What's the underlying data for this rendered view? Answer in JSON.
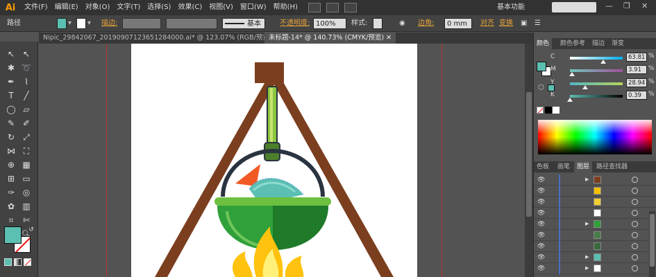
{
  "app": {
    "logo": "Ai"
  },
  "menu": [
    "文件(F)",
    "编辑(E)",
    "对象(O)",
    "文字(T)",
    "选择(S)",
    "效果(C)",
    "视图(V)",
    "窗口(W)",
    "帮助(H)"
  ],
  "workspace_label": "基本功能",
  "control": {
    "selection_label": "路径",
    "stroke_label": "描边:",
    "profile_label": "基本",
    "opacity_label": "不透明度:",
    "opacity_value": "100%",
    "style_label": "样式:",
    "align_label": "边角:",
    "corner_value": "0 mm",
    "align_link": "对齐",
    "transform_link": "变换"
  },
  "tabs": [
    {
      "label": "Nipic_29842067_20190907123651284000.ai* @ 123.07% (RGB/预览)",
      "active": false
    },
    {
      "label": "未标题-14* @ 140.73% (CMYK/预览)",
      "active": true
    }
  ],
  "color_panel": {
    "tabs": [
      "颜色",
      "颜色参考",
      "描边",
      "渐变"
    ],
    "channels": [
      {
        "label": "C",
        "value": "63.81",
        "gradient": "linear-gradient(to right,#fff,#00aeef)",
        "level": 0.6381
      },
      {
        "label": "M",
        "value": "3.91",
        "gradient": "linear-gradient(to right,#6fc7bb,#a0509a)",
        "level": 0.0391
      },
      {
        "label": "Y",
        "value": "28.94",
        "gradient": "linear-gradient(to right,#52b7c7,#b7d45a)",
        "level": 0.2894
      },
      {
        "label": "K",
        "value": "0.39",
        "gradient": "linear-gradient(to right,#5bbfb2,#000)",
        "level": 0.0039
      }
    ],
    "pct": "%"
  },
  "layers_panel": {
    "tabs": [
      "色板",
      "画笔",
      "图层",
      "路径查找器"
    ],
    "rows": [
      {
        "thumb_color": "#7b3f1f",
        "expandable": true
      },
      {
        "thumb_color": "#f5c000",
        "expandable": false
      },
      {
        "thumb_color": "#f2d030",
        "expandable": false
      },
      {
        "thumb_color": "#ffffff",
        "expandable": false
      },
      {
        "thumb_color": "#2fa03a",
        "expandable": true
      },
      {
        "thumb_color": "#4a7c4a",
        "expandable": false
      },
      {
        "thumb_color": "#3a6a3a",
        "expandable": false
      },
      {
        "thumb_color": "#5bbfb2",
        "expandable": true
      },
      {
        "thumb_color": "#ffffff",
        "expandable": true
      }
    ]
  },
  "colors": {
    "fill": "#5bbfb2",
    "tripod": "#7b3f1f",
    "pot_green": "#2fa03a",
    "pot_dark": "#1f7a2a",
    "handle": "#2a3340",
    "chain": "#8cc63f",
    "fish": "#5bbfb2",
    "fin": "#f15a24",
    "flame_outer": "#ffc20e",
    "flame_inner": "#fff07a"
  }
}
